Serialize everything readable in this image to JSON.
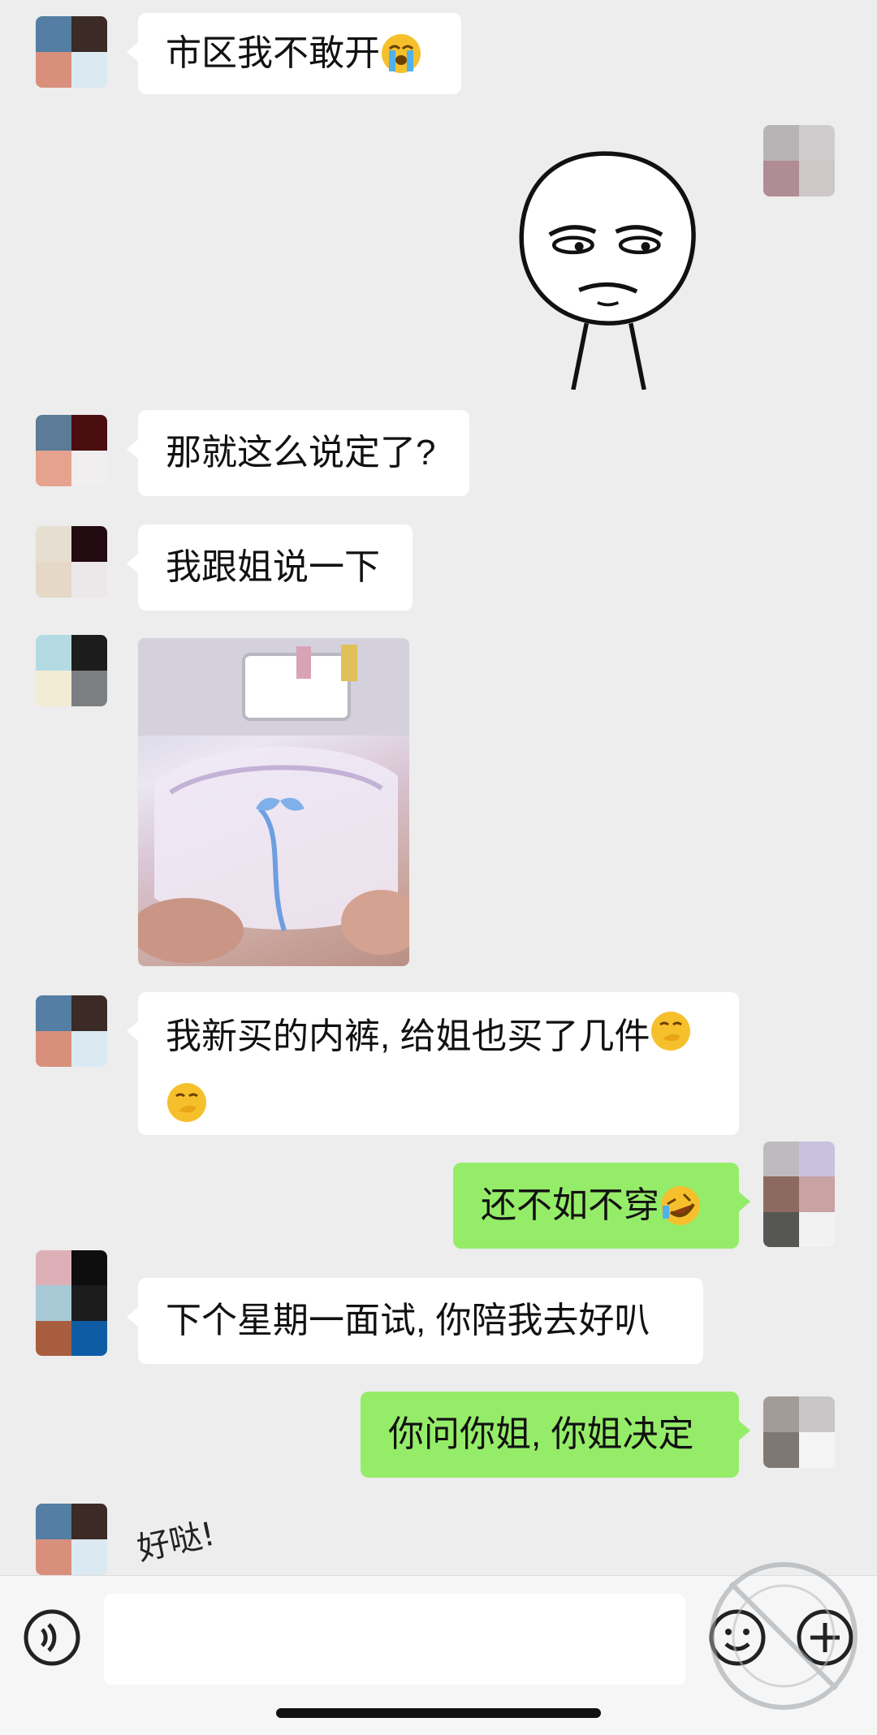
{
  "colors": {
    "background": "#ededed",
    "incoming_bubble": "#ffffff",
    "outgoing_bubble": "#95ec69",
    "text": "#111111"
  },
  "messages": [
    {
      "id": "m1",
      "side": "incoming",
      "type": "text",
      "text": "市区我不敢开",
      "emoji": "loudly-crying-face"
    },
    {
      "id": "m2",
      "side": "outgoing",
      "type": "sticker",
      "sticker": "unimpressed-meme-face"
    },
    {
      "id": "m3",
      "side": "incoming",
      "type": "text",
      "text": "那就这么说定了?"
    },
    {
      "id": "m4",
      "side": "incoming",
      "type": "text",
      "text": "我跟姐说一下"
    },
    {
      "id": "m5",
      "side": "incoming",
      "type": "image",
      "image": "photo-lace-lingerie"
    },
    {
      "id": "m6",
      "side": "incoming",
      "type": "text",
      "text": "我新买的内裤, 给姐也买了几件",
      "emoji": "face-with-hand-over-mouth"
    },
    {
      "id": "m7",
      "side": "outgoing",
      "type": "text",
      "text": "还不如不穿",
      "emoji": "rolling-on-floor-laughing"
    },
    {
      "id": "m8",
      "side": "incoming",
      "type": "text",
      "text": "下个星期一面试, 你陪我去好叭"
    },
    {
      "id": "m9",
      "side": "outgoing",
      "type": "text",
      "text": "你问你姐, 你姐决定"
    },
    {
      "id": "m10",
      "side": "incoming",
      "type": "sticker",
      "sticker_text": "好哒!"
    }
  ],
  "input_bar": {
    "voice_icon": "voice-icon",
    "emoji_icon": "emoji-icon",
    "plus_icon": "plus-icon"
  }
}
